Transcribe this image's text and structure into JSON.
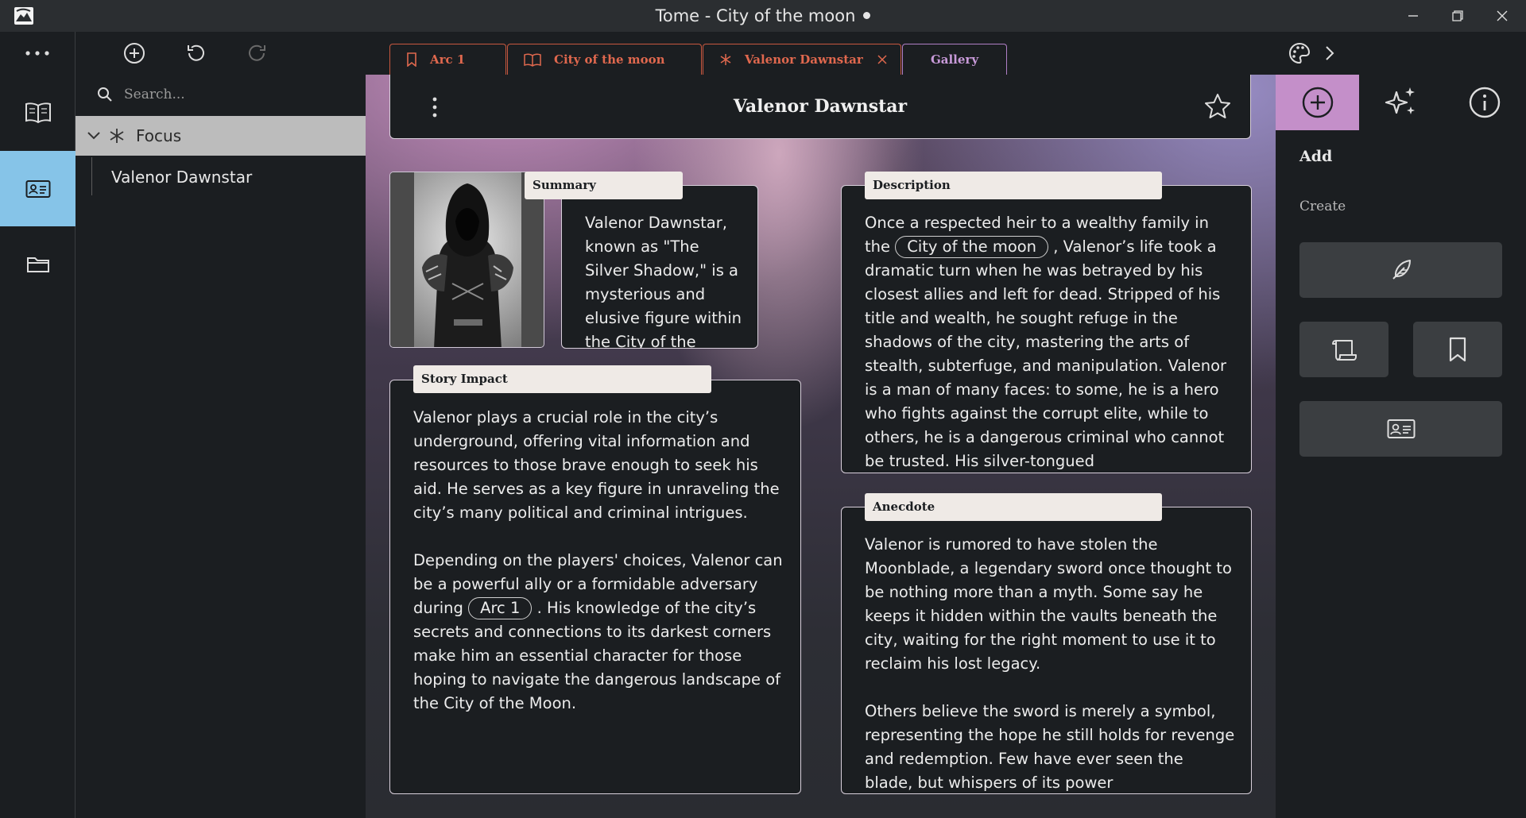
{
  "window": {
    "title": "Tome - City of the moon",
    "unsaved_indicator": "dot",
    "app_icon": "mountain-icon",
    "controls": [
      "minimize-icon",
      "restore-icon",
      "close-icon"
    ]
  },
  "toolbar": {
    "buttons": [
      "more-icon",
      "add-circle-icon",
      "undo-icon",
      "redo-icon"
    ],
    "right_buttons": [
      "palette-icon",
      "chevron-right-icon"
    ]
  },
  "tabs": [
    {
      "label": "Arc 1",
      "icon": "bookmark-icon"
    },
    {
      "label": "City of the moon",
      "icon": "open-book-icon"
    },
    {
      "label": "Valenor Dawnstar",
      "icon": "asterisk-icon",
      "closable": true
    },
    {
      "label": "Gallery"
    }
  ],
  "rail": {
    "items": [
      "book-icon",
      "id-card-icon",
      "folder-icon"
    ],
    "active_index": 1
  },
  "sidebar": {
    "search_placeholder": "Search...",
    "group_label": "Focus",
    "items": [
      "Valenor Dawnstar"
    ]
  },
  "page": {
    "title": "Valenor Dawnstar",
    "summary_label": "Summary",
    "summary_text": "Valenor Dawnstar, known as \"The Silver Shadow,\" is a mysterious and elusive figure within the City of the Moon. A former",
    "impact_label": "Story Impact",
    "impact_p1": "Valenor plays a crucial role in the city’s underground, offering vital information and resources to those brave enough to seek his aid. He serves as a key figure in unraveling the city’s many political and criminal intrigues.",
    "impact_p2_before": "Depending on the players' choices, Valenor can be a powerful ally or a formidable adversary during",
    "impact_p2_link": "Arc 1",
    "impact_p2_after": ". His knowledge of the city’s secrets and connections to its darkest corners make him an essential character for those hoping to navigate the dangerous landscape of the City of the Moon.",
    "description_label": "Description",
    "description_before": "Once a respected heir to a wealthy family in the",
    "description_link": "City of the moon",
    "description_after": ", Valenor’s life took a dramatic turn when he was betrayed by his closest allies and left for dead. Stripped of his title and wealth, he sought refuge in the shadows of the city, mastering the arts of stealth, subterfuge, and manipulation. Valenor is a man of many faces: to some, he is a hero who fights against the corrupt elite, while to others, he is a dangerous criminal who cannot be trusted. His silver-tongued",
    "anecdote_label": "Anecdote",
    "anecdote_p1": "Valenor is rumored to have stolen the Moonblade, a legendary sword once thought to be nothing more than a myth. Some say he keeps it hidden within the vaults beneath the city, waiting for the right moment to use it to reclaim his lost legacy.",
    "anecdote_p2": "Others believe the sword is merely a symbol, representing the hope he still holds for revenge and redemption. Few have ever seen the blade, but whispers of its power"
  },
  "right_panel": {
    "tabs": [
      "add-circle-icon",
      "sparkles-icon",
      "info-icon"
    ],
    "active_tab": 0,
    "title": "Add",
    "subtitle": "Create",
    "buttons": [
      "feather-icon",
      "scroll-icon",
      "bookmark-icon",
      "id-card-icon"
    ]
  },
  "colors": {
    "tab_accent": "#e0684e",
    "gallery_accent": "#c89ad9",
    "rail_active": "#86c4e8",
    "panel_active": "#c48fc9"
  }
}
